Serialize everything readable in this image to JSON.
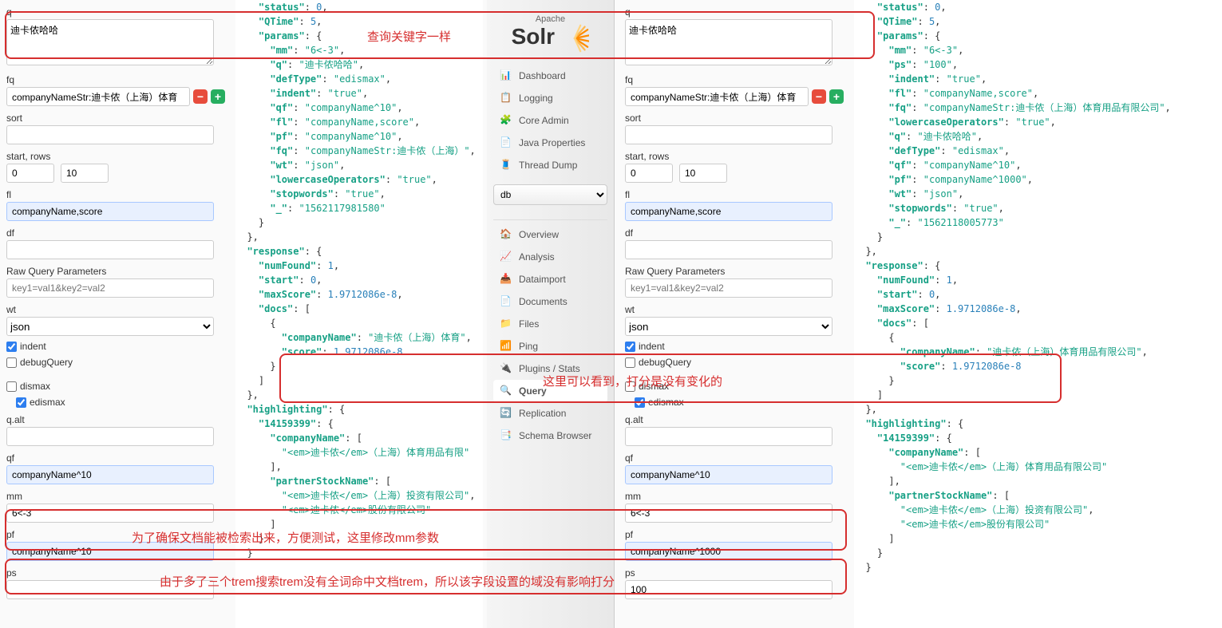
{
  "logo": {
    "apache": "Apache",
    "solr": "Solr"
  },
  "nav_main": [
    {
      "label": "Dashboard",
      "icon": "dashboard"
    },
    {
      "label": "Logging",
      "icon": "logging"
    },
    {
      "label": "Core Admin",
      "icon": "coreadmin"
    },
    {
      "label": "Java Properties",
      "icon": "java"
    },
    {
      "label": "Thread Dump",
      "icon": "thread"
    }
  ],
  "core_selected": "db",
  "nav_sub": [
    {
      "label": "Overview",
      "icon": "overview"
    },
    {
      "label": "Analysis",
      "icon": "analysis"
    },
    {
      "label": "Dataimport",
      "icon": "dataimport"
    },
    {
      "label": "Documents",
      "icon": "documents"
    },
    {
      "label": "Files",
      "icon": "files"
    },
    {
      "label": "Ping",
      "icon": "ping"
    },
    {
      "label": "Plugins / Stats",
      "icon": "plugins"
    },
    {
      "label": "Query",
      "icon": "query",
      "selected": true
    },
    {
      "label": "Replication",
      "icon": "replication"
    },
    {
      "label": "Schema Browser",
      "icon": "schema"
    }
  ],
  "formL": {
    "q_label": "q",
    "q": "迪卡侬哈哈",
    "fq_label": "fq",
    "fq": "companyNameStr:迪卡侬（上海）体育",
    "sort_label": "sort",
    "sort": "",
    "startrows_label": "start, rows",
    "start": "0",
    "rows": "10",
    "fl_label": "fl",
    "fl": "companyName,score",
    "df_label": "df",
    "df": "",
    "raw_label": "Raw Query Parameters",
    "raw_ph": "key1=val1&key2=val2",
    "wt_label": "wt",
    "wt": "json",
    "indent_label": "indent",
    "indent": true,
    "debug_label": "debugQuery",
    "debug": false,
    "dismax_label": "dismax",
    "dismax": false,
    "edismax_label": "edismax",
    "edismax": true,
    "qalt_label": "q.alt",
    "qalt": "",
    "qf_label": "qf",
    "qf": "companyName^10",
    "mm_label": "mm",
    "mm": "6<-3",
    "pf_label": "pf",
    "pf": "companyName^10",
    "ps_label": "ps"
  },
  "formR": {
    "q_label": "q",
    "q": "迪卡侬哈哈",
    "fq_label": "fq",
    "fq": "companyNameStr:迪卡侬（上海）体育",
    "sort_label": "sort",
    "sort": "",
    "startrows_label": "start, rows",
    "start": "0",
    "rows": "10",
    "fl_label": "fl",
    "fl": "companyName,score",
    "df_label": "df",
    "df": "",
    "raw_label": "Raw Query Parameters",
    "raw_ph": "key1=val1&key2=val2",
    "wt_label": "wt",
    "wt": "json",
    "indent_label": "indent",
    "indent": true,
    "debug_label": "debugQuery",
    "debug": false,
    "dismax_label": "dismax",
    "dismax": false,
    "edismax_label": "edismax",
    "edismax": true,
    "qalt_label": "q.alt",
    "qalt": "",
    "qf_label": "qf",
    "qf": "companyName^10",
    "mm_label": "mm",
    "mm": "6<-3",
    "pf_label": "pf",
    "pf": "companyName^1000",
    "ps_label": "ps",
    "ps": "100"
  },
  "jsonL": {
    "status": 0,
    "QTime": 5,
    "params": {
      "mm": "6<-3",
      "q": "迪卡侬哈哈",
      "defType": "edismax",
      "indent": "true",
      "qf": "companyName^10",
      "fl": "companyName,score",
      "pf": "companyName^10",
      "fq": "companyNameStr:迪卡侬（上海）",
      "wt": "json",
      "lowercaseOperators": "true",
      "stopwords": "true",
      "_": "1562117981580"
    },
    "response": {
      "numFound": 1,
      "start": 0,
      "maxScore": "1.9712086e-8",
      "docs": [
        {
          "companyName": "迪卡侬（上海）体育",
          "score": "1.9712086e-8"
        }
      ]
    },
    "highlighting": {
      "id": "14159399",
      "companyName": "<em>迪卡侬</em>（上海）体育用品有限",
      "partnerStockName": [
        "<em>迪卡侬</em>（上海）投资有限公司",
        "<em>迪卡侬</em>股份有限公司"
      ]
    }
  },
  "jsonR": {
    "status": 0,
    "QTime": 5,
    "params": {
      "mm": "6<-3",
      "ps": "100",
      "indent": "true",
      "fl": "companyName,score",
      "fq": "companyNameStr:迪卡侬（上海）体育用品有限公司",
      "lowercaseOperators": "true",
      "q": "迪卡侬哈哈",
      "defType": "edismax",
      "qf": "companyName^10",
      "pf": "companyName^1000",
      "wt": "json",
      "stopwords": "true",
      "_": "1562118005773"
    },
    "response": {
      "numFound": 1,
      "start": 0,
      "maxScore": "1.9712086e-8",
      "docs": [
        {
          "companyName": "迪卡侬（上海）体育用品有限公司",
          "score": "1.9712086e-8"
        }
      ]
    },
    "highlighting": {
      "id": "14159399",
      "companyName": "<em>迪卡侬</em>（上海）体育用品有限公司",
      "partnerStockName": [
        "<em>迪卡侬</em>（上海）投资有限公司",
        "<em>迪卡侬</em>股份有限公司"
      ]
    }
  },
  "annotations": {
    "a1": "查询关键字一样",
    "a2": "这里可以看到，打分是没有变化的",
    "a3": "为了确保文档能被检索出来，方便测试，这里修改mm参数",
    "a4": "由于多了三个trem搜索trem没有全词命中文档trem，所以该字段设置的域没有影响打分"
  }
}
